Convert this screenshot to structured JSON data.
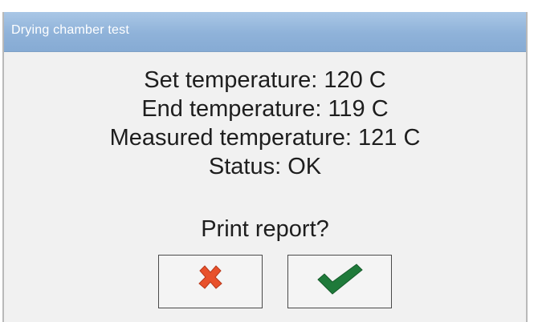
{
  "dialog": {
    "title": "Drying chamber test",
    "lines": [
      "Set temperature: 120  C",
      "End temperature: 119  C",
      "Measured temperature: 121  C",
      "Status: OK"
    ],
    "prompt": "Print report?"
  },
  "buttons": {
    "cancel_icon": "cross-icon",
    "confirm_icon": "checkmark-icon"
  },
  "colors": {
    "titlebar": "#8fb2d9",
    "cancel_icon": "#e8512b",
    "confirm_icon": "#1f7a3a"
  }
}
